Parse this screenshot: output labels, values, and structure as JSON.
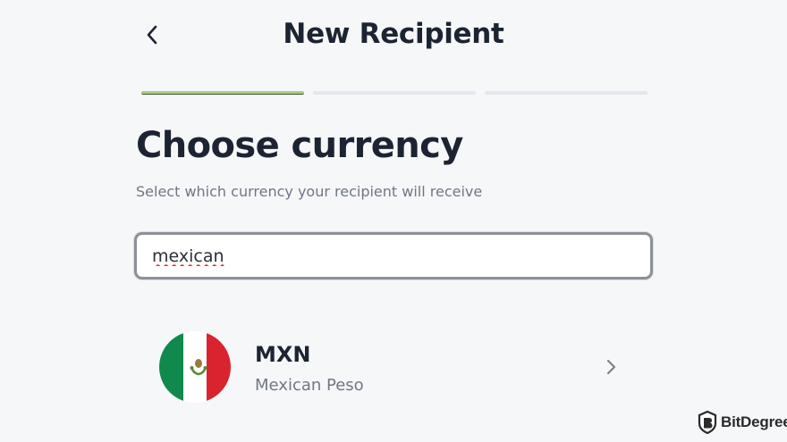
{
  "header": {
    "title": "New Recipient",
    "back_icon": "chevron-left-icon"
  },
  "progress": {
    "steps_total": 3,
    "current_step": 1,
    "active_color": "#a9cc87",
    "inactive_color": "#e4e7ee"
  },
  "main": {
    "title": "Choose currency",
    "subtitle": "Select which currency your recipient will receive"
  },
  "search": {
    "value": "mexican",
    "spellcheck_error": true
  },
  "results": [
    {
      "code": "MXN",
      "name": "Mexican Peso",
      "flag_icon": "mexico-flag-icon",
      "flag_colors": [
        "#0f8a4c",
        "#ffffff",
        "#d9232e"
      ]
    }
  ],
  "watermark": {
    "text": "BitDegree"
  }
}
